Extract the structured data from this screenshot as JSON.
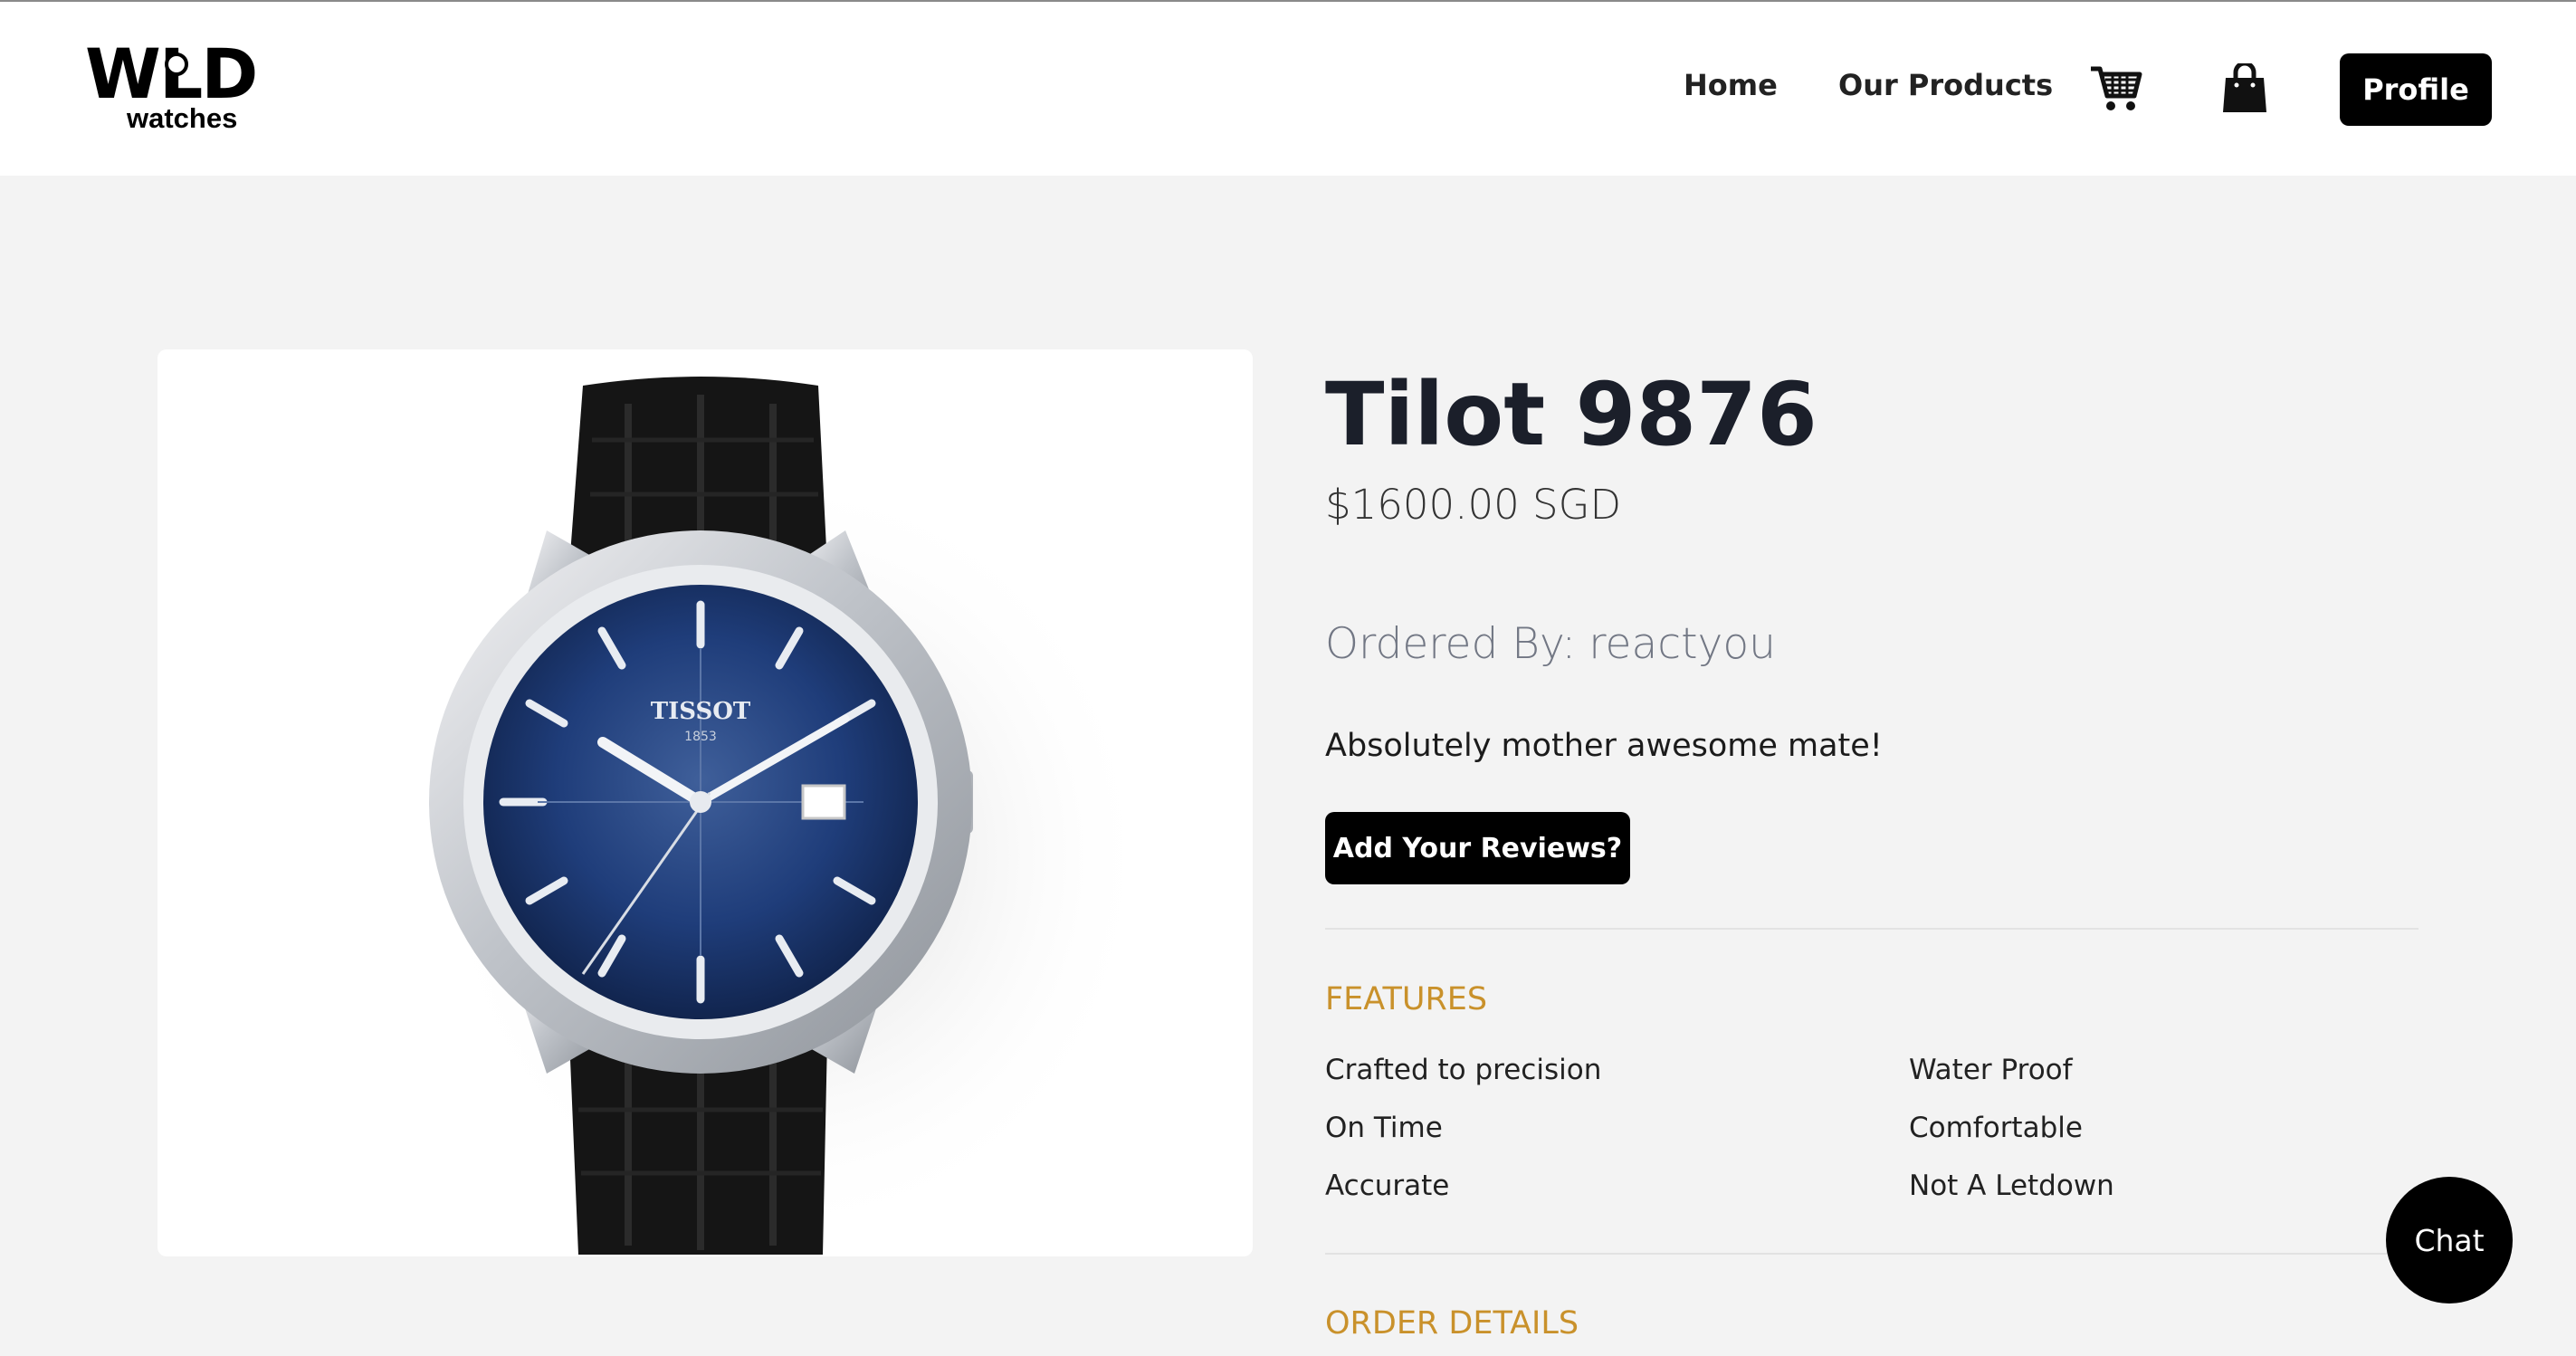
{
  "brand": {
    "logo_main": "WLD",
    "logo_sub": "watches"
  },
  "nav": {
    "home": "Home",
    "products": "Our Products",
    "cart_icon": "cart-icon",
    "bag_icon": "shopping-bag-icon",
    "profile": "Profile"
  },
  "product": {
    "image_alt": "watch-product-image",
    "title": "Tilot 9876",
    "price": "$1600.00 SGD",
    "ordered_by_label": "Ordered By:",
    "ordered_by_user": "reactyou",
    "review": "Absolutely mother awesome mate!",
    "add_review_label": "Add Your Reviews?",
    "watch_brand": "TISSOT",
    "watch_year": "1853"
  },
  "features": {
    "heading": "FEATURES",
    "items": [
      "Crafted to precision",
      "Water Proof",
      "On Time",
      "Comfortable",
      "Accurate",
      "Not A Letdown"
    ]
  },
  "order_details": {
    "heading": "ORDER DETAILS"
  },
  "chat": {
    "label": "Chat"
  },
  "colors": {
    "accent": "#c9912b",
    "button": "#000000",
    "page_bg": "#f3f3f3",
    "dial": "#1f3d7a"
  }
}
